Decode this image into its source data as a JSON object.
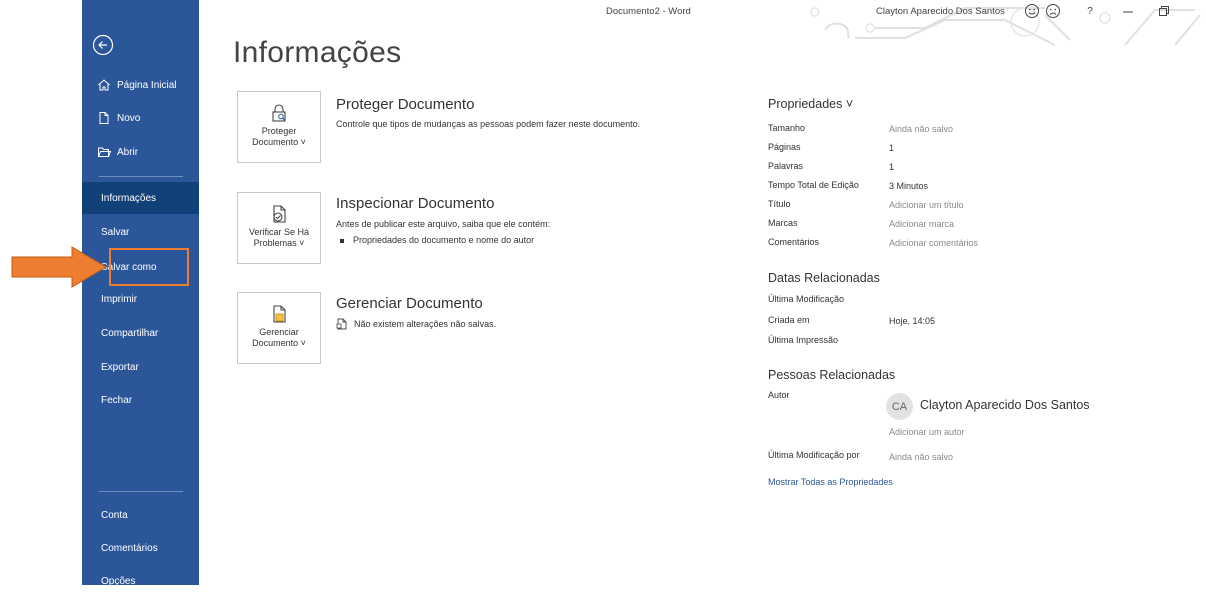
{
  "window": {
    "title": "Documento2  -  Word",
    "user_name": "Clayton Aparecido Dos Santos",
    "help": "?"
  },
  "sidebar": {
    "back_icon": "back-arrow-icon",
    "top_items": [
      {
        "label": "Página Inicial",
        "icon": "home-icon"
      },
      {
        "label": "Novo",
        "icon": "new-document-icon"
      },
      {
        "label": "Abrir",
        "icon": "open-folder-icon"
      }
    ],
    "items": [
      {
        "label": "Informações",
        "active": true
      },
      {
        "label": "Salvar"
      },
      {
        "label": "Salvar como"
      },
      {
        "label": "Imprimir"
      },
      {
        "label": "Compartilhar"
      },
      {
        "label": "Exportar"
      },
      {
        "label": "Fechar"
      }
    ],
    "bottom_items": [
      {
        "label": "Conta"
      },
      {
        "label": "Comentários"
      },
      {
        "label": "Opções"
      }
    ]
  },
  "main": {
    "title": "Informações",
    "sections": [
      {
        "tile_label_line1": "Proteger",
        "tile_label_line2": "Documento ˅",
        "title": "Proteger Documento",
        "description": "Controle que tipos de mudanças as pessoas podem fazer neste documento."
      },
      {
        "tile_label_line1": "Verificar Se Há",
        "tile_label_line2": "Problemas ˅",
        "title": "Inspecionar Documento",
        "description": "Antes de publicar este arquivo, saiba que ele contém:",
        "bullets": [
          "Propriedades do documento e nome do autor"
        ]
      },
      {
        "tile_label_line1": "Gerenciar",
        "tile_label_line2": "Documento ˅",
        "title": "Gerenciar Documento",
        "description": "Não existem alterações não salvas."
      }
    ]
  },
  "properties": {
    "heading": "Propriedades ˅",
    "rows": [
      {
        "label": "Tamanho",
        "value": "Ainda não salvo"
      },
      {
        "label": "Páginas",
        "value": "1"
      },
      {
        "label": "Palavras",
        "value": "1"
      },
      {
        "label": "Tempo Total de Edição",
        "value": "3 Minutos"
      },
      {
        "label": "Título",
        "value": "Adicionar um título"
      },
      {
        "label": "Marcas",
        "value": "Adicionar marca"
      },
      {
        "label": "Comentários",
        "value": "Adicionar comentários"
      }
    ],
    "dates_heading": "Datas Relacionadas",
    "dates": [
      {
        "label": "Última Modificação",
        "value": ""
      },
      {
        "label": "Criada em",
        "value": "Hoje, 14:05"
      },
      {
        "label": "Última Impressão",
        "value": ""
      }
    ],
    "people_heading": "Pessoas Relacionadas",
    "author_label": "Autor",
    "author_initials": "CA",
    "author_name": "Clayton Aparecido Dos Santos",
    "add_author": "Adicionar um autor",
    "last_modified_by_label": "Última Modificação por",
    "last_modified_by_value": "Ainda não salvo",
    "show_all_link": "Mostrar Todas as Propriedades"
  },
  "colors": {
    "sidebar": "#2b579a",
    "active": "#124078",
    "annotation": "#ed7d31"
  }
}
